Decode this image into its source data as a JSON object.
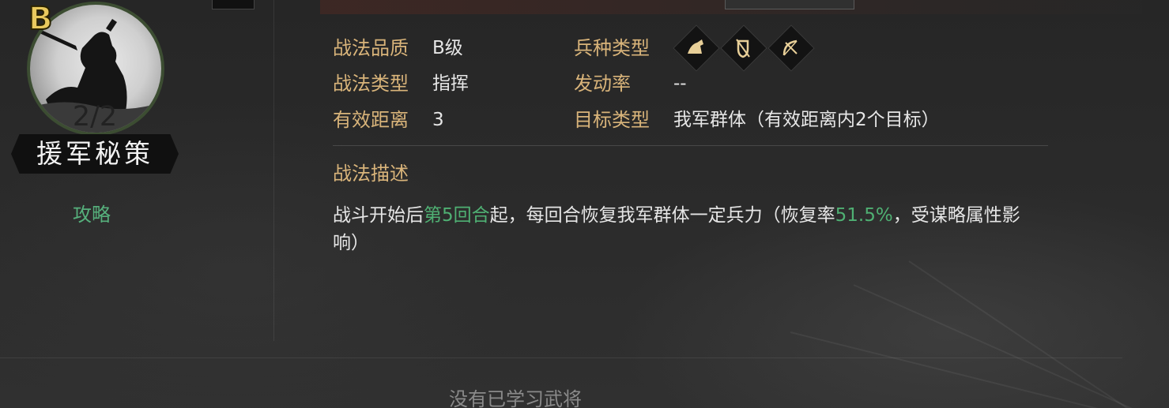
{
  "skill": {
    "grade": "B",
    "count": "2/2",
    "name": "援军秘策",
    "guide_link": "攻略"
  },
  "info": {
    "quality_label": "战法品质",
    "quality_value": "B级",
    "type_label": "战法类型",
    "type_value": "指挥",
    "range_label": "有效距离",
    "range_value": "3",
    "troop_label": "兵种类型",
    "troop_icons": [
      "cavalry-icon",
      "shield-icon",
      "archer-icon"
    ],
    "trigger_label": "发动率",
    "trigger_value": "--",
    "target_label": "目标类型",
    "target_value": "我军群体（有效距离内2个目标）"
  },
  "description": {
    "title": "战法描述",
    "part1": "战斗开始后",
    "highlight1": "第5回合",
    "part2": "起，每回合恢复我军群体一定兵力（恢复率",
    "highlight2": "51.5%",
    "part3": "，受谋略属性影响）"
  },
  "footer": {
    "no_general": "没有已学习武将"
  },
  "colors": {
    "label": "#d9b47a",
    "highlight": "#4fb073",
    "grade": "#e9c95e",
    "text": "#e6e6e6"
  }
}
